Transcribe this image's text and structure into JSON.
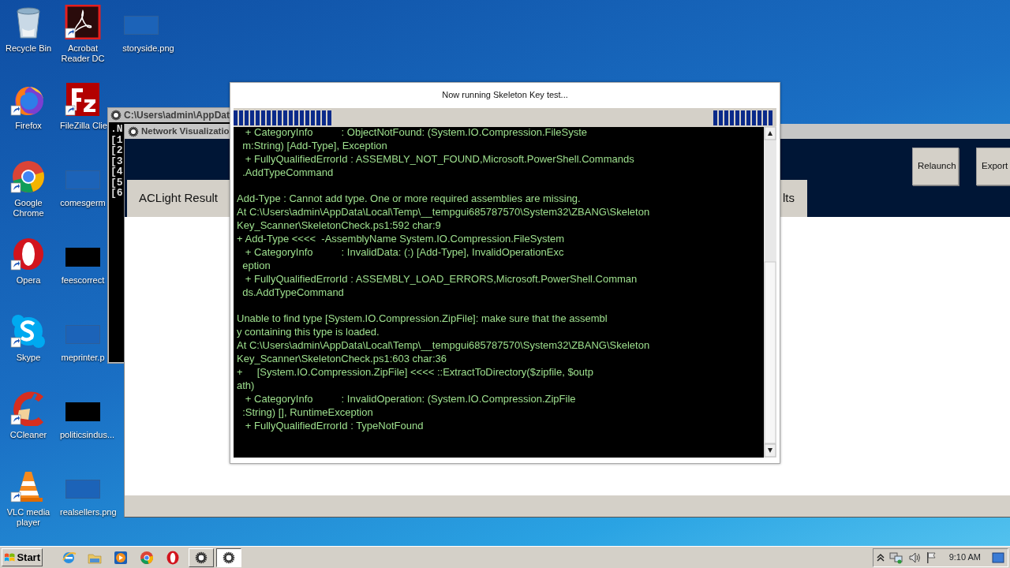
{
  "desktop": {
    "columns": [
      [
        {
          "label": "Recycle Bin",
          "kind": "recycle",
          "shortcut": false
        },
        {
          "label": "Firefox",
          "kind": "firefox",
          "shortcut": true
        },
        {
          "label": "Google\nChrome",
          "kind": "chrome",
          "shortcut": true
        },
        {
          "label": "Opera",
          "kind": "opera",
          "shortcut": true
        },
        {
          "label": "Skype",
          "kind": "skype",
          "shortcut": true
        },
        {
          "label": "CCleaner",
          "kind": "ccleaner",
          "shortcut": true
        },
        {
          "label": "VLC media\nplayer",
          "kind": "vlc",
          "shortcut": true
        }
      ],
      [
        {
          "label": "Acrobat\nReader DC",
          "kind": "acrobat",
          "shortcut": true
        },
        {
          "label": "FileZilla Clie",
          "kind": "filezilla",
          "shortcut": true
        },
        {
          "label": "comesgerm",
          "kind": "file-blank"
        },
        {
          "label": "feescorrect",
          "kind": "file-dark"
        },
        {
          "label": "meprinter.p",
          "kind": "file-blank"
        },
        {
          "label": "politicsindus...",
          "kind": "file-dark"
        },
        {
          "label": "realsellers.png",
          "kind": "file-blank"
        }
      ],
      [
        {
          "label": "storyside.png",
          "kind": "file-blank"
        }
      ]
    ]
  },
  "console_window": {
    "title": "C:\\Users\\admin\\AppDat",
    "lines": [
      ".N",
      "[1",
      "[2",
      "[3",
      "[4",
      "[5",
      "[6"
    ]
  },
  "app_window": {
    "title": "Network Visualizatio",
    "tabs": [
      {
        "label": "ACLight Result",
        "selected": false
      },
      {
        "label": "lts",
        "selected": false
      }
    ],
    "buttons": [
      "Relaunch",
      "Export"
    ]
  },
  "dialog": {
    "title": "Now running Skeleton Key test...",
    "output_blocks": [
      [
        "   + CategoryInfo          : ObjectNotFound: (System.IO.Compression.FileSyste",
        "  m:String) [Add-Type], Exception",
        "   + FullyQualifiedErrorId : ASSEMBLY_NOT_FOUND,Microsoft.PowerShell.Commands",
        "  .AddTypeCommand"
      ],
      [
        "Add-Type : Cannot add type. One or more required assemblies are missing.",
        "At C:\\Users\\admin\\AppData\\Local\\Temp\\__tempgui685787570\\System32\\ZBANG\\Skeleton",
        "Key_Scanner\\SkeletonCheck.ps1:592 char:9",
        "+ Add-Type <<<<  -AssemblyName System.IO.Compression.FileSystem",
        "   + CategoryInfo          : InvalidData: (:) [Add-Type], InvalidOperationExc",
        "  eption",
        "   + FullyQualifiedErrorId : ASSEMBLY_LOAD_ERRORS,Microsoft.PowerShell.Comman",
        "  ds.AddTypeCommand"
      ],
      [
        "Unable to find type [System.IO.Compression.ZipFile]: make sure that the assembl",
        "y containing this type is loaded.",
        "At C:\\Users\\admin\\AppData\\Local\\Temp\\__tempgui685787570\\System32\\ZBANG\\Skeleton",
        "Key_Scanner\\SkeletonCheck.ps1:603 char:36",
        "+     [System.IO.Compression.ZipFile] <<<< ::ExtractToDirectory($zipfile, $outp",
        "ath)",
        "   + CategoryInfo          : InvalidOperation: (System.IO.Compression.ZipFile",
        "  :String) [], RuntimeException",
        "   + FullyQualifiedErrorId : TypeNotFound"
      ]
    ]
  },
  "taskbar": {
    "start": "Start",
    "quick_launch": [
      {
        "kind": "ie"
      },
      {
        "kind": "explorer"
      },
      {
        "kind": "media"
      },
      {
        "kind": "chrome"
      },
      {
        "kind": "opera"
      }
    ],
    "tasks": [
      {
        "selected": false
      },
      {
        "selected": true
      }
    ],
    "clock": "9:10 AM"
  }
}
